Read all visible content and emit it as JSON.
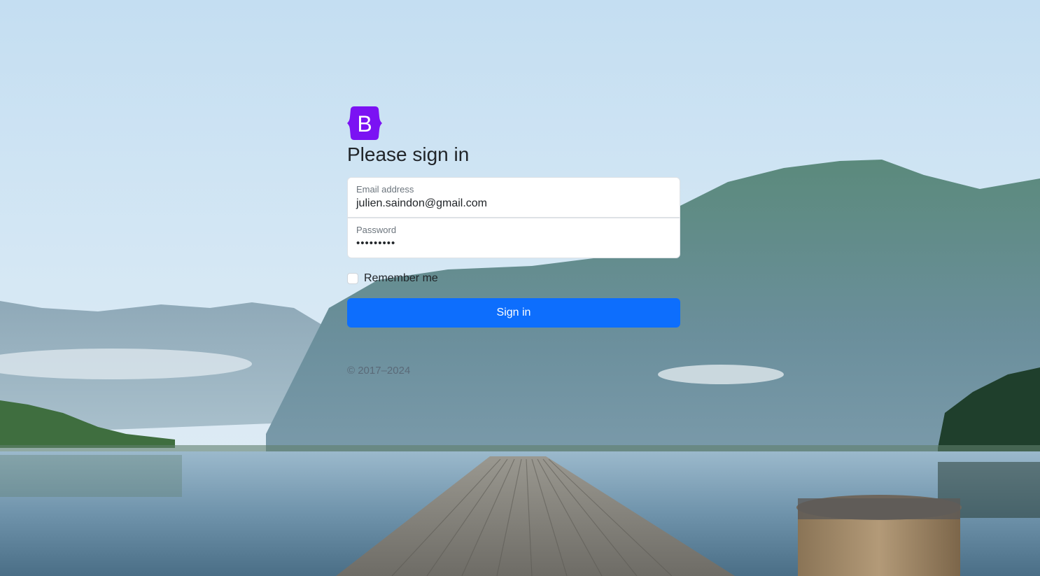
{
  "brand": {
    "logo_letter": "B",
    "logo_color": "#7b12f3"
  },
  "page": {
    "title": "Please sign in"
  },
  "form": {
    "email_label": "Email address",
    "email_value": "julien.saindon@gmail.com",
    "password_label": "Password",
    "password_value": "•••••••••",
    "remember_label": "Remember me",
    "remember_checked": false,
    "submit_label": "Sign in",
    "submit_color": "#0d6efd"
  },
  "footer": {
    "copyright": "© 2017–2024"
  },
  "background": {
    "sky_color": "#cde3f2",
    "mountain_color": "#5f8aa0",
    "water_color": "#7fa4bd"
  }
}
